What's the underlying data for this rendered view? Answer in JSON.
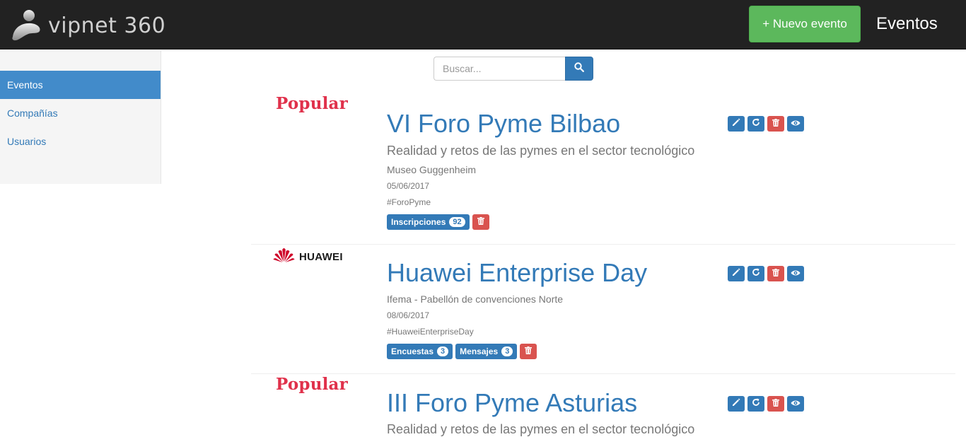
{
  "header": {
    "logo_text": "vipnet 360",
    "new_event_label": "+ Nuevo evento",
    "page_title": "Eventos"
  },
  "sidebar": {
    "items": [
      {
        "label": "Eventos",
        "active": true
      },
      {
        "label": "Compañías",
        "active": false
      },
      {
        "label": "Usuarios",
        "active": false
      }
    ]
  },
  "search": {
    "placeholder": "Buscar...",
    "value": "",
    "icon": "search-icon"
  },
  "events": [
    {
      "logo_text": "Popular",
      "title": "VI Foro Pyme Bilbao",
      "subtitle": "Realidad y retos de las pymes en el sector tecnológico",
      "location": "Museo Guggenheim",
      "date": "05/06/2017",
      "hashtag": "#ForoPyme",
      "badges": [
        {
          "label": "Inscripciones",
          "count": "92"
        }
      ]
    },
    {
      "logo_text": "HUAWEI",
      "title": "Huawei Enterprise Day",
      "subtitle": "",
      "location": "Ifema - Pabellón de convenciones Norte",
      "date": "08/06/2017",
      "hashtag": "#HuaweiEnterpriseDay",
      "badges": [
        {
          "label": "Encuestas",
          "count": "3"
        },
        {
          "label": "Mensajes",
          "count": "3"
        }
      ]
    },
    {
      "logo_text": "Popular",
      "title": "III Foro Pyme Asturias",
      "subtitle": "Realidad y retos de las pymes en el sector tecnológico",
      "location": "",
      "date": "",
      "hashtag": "",
      "badges": []
    }
  ],
  "colors": {
    "topbar": "#222222",
    "success": "#5cb85c",
    "primary": "#337ab7",
    "danger": "#d9534f",
    "popular_red": "#e0314b",
    "huawei_red": "#cf0a2c"
  },
  "action_icons": [
    "pencil-icon",
    "refresh-icon",
    "trash-icon",
    "eye-icon"
  ]
}
